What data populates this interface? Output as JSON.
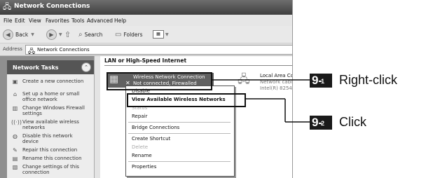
{
  "window": {
    "title": "Network Connections"
  },
  "menubar": [
    "File",
    "Edit",
    "View",
    "Favorites",
    "Tools",
    "Advanced",
    "Help"
  ],
  "toolbar": {
    "back": "Back",
    "search": "Search",
    "folders": "Folders"
  },
  "address": {
    "label": "Address",
    "value": "Network Connections"
  },
  "tasks": {
    "header": "Network Tasks",
    "items": [
      "Create a new connection",
      "Set up a home or small office network",
      "Change Windows Firewall settings",
      "View available wireless networks",
      "Disable this network device",
      "Repair this connection",
      "Rename this connection",
      "Change settings of this connection"
    ]
  },
  "main": {
    "section": "LAN or High-Speed Internet",
    "wireless": {
      "line1": "Wireless Network Connection",
      "line2": "Not connected, Firewalled"
    },
    "local": {
      "line1": "Local Area Co",
      "line2": "Network cabl",
      "line3": "Intel(R) 8254"
    }
  },
  "context_menu": [
    "Disable",
    "View Available Wireless Networks",
    "Status",
    "Repair",
    "Bridge Connections",
    "Create Shortcut",
    "Delete",
    "Rename",
    "Properties"
  ],
  "annotations": [
    {
      "step_main": "9",
      "step_sub": "1",
      "label": "Right-click"
    },
    {
      "step_main": "9",
      "step_sub": "2",
      "label": "Click"
    }
  ]
}
